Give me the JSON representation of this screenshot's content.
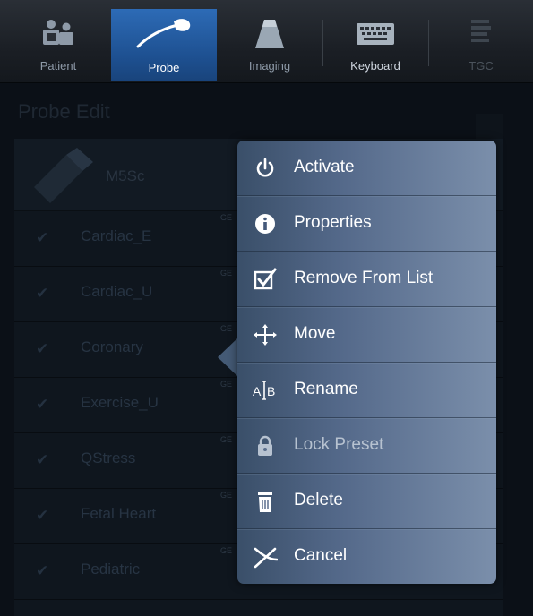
{
  "tabs": [
    {
      "label": "Patient",
      "icon": "patient-icon",
      "state": "normal"
    },
    {
      "label": "Probe",
      "icon": "probe-icon",
      "state": "active"
    },
    {
      "label": "Imaging",
      "icon": "imaging-icon",
      "state": "normal"
    },
    {
      "label": "Keyboard",
      "icon": "keyboard-icon",
      "state": "normal"
    },
    {
      "label": "TGC",
      "icon": "tgc-icon",
      "state": "disabled"
    }
  ],
  "panel": {
    "title": "Probe Edit",
    "probe_name": "M5Sc",
    "presets": [
      {
        "name": "Cardiac_E",
        "tag": "GE"
      },
      {
        "name": "Cardiac_U",
        "tag": "GE"
      },
      {
        "name": "Coronary",
        "tag": "GE"
      },
      {
        "name": "Exercise_U",
        "tag": "GE"
      },
      {
        "name": "QStress",
        "tag": "GE"
      },
      {
        "name": "Fetal Heart",
        "tag": "GE"
      },
      {
        "name": "Pediatric",
        "tag": "GE"
      }
    ]
  },
  "menu": {
    "items": [
      {
        "label": "Activate",
        "icon": "power-icon",
        "enabled": true
      },
      {
        "label": "Properties",
        "icon": "info-icon",
        "enabled": true
      },
      {
        "label": "Remove From List",
        "icon": "checkbox-icon",
        "enabled": true
      },
      {
        "label": "Move",
        "icon": "move-icon",
        "enabled": true
      },
      {
        "label": "Rename",
        "icon": "rename-icon",
        "enabled": true
      },
      {
        "label": "Lock Preset",
        "icon": "lock-icon",
        "enabled": false
      },
      {
        "label": "Delete",
        "icon": "trash-icon",
        "enabled": true
      },
      {
        "label": "Cancel",
        "icon": "cancel-icon",
        "enabled": true
      }
    ]
  },
  "colors": {
    "active_tab": "#2d6bb6",
    "menu_start": "#3a4f69",
    "menu_end": "#7b8fab"
  }
}
